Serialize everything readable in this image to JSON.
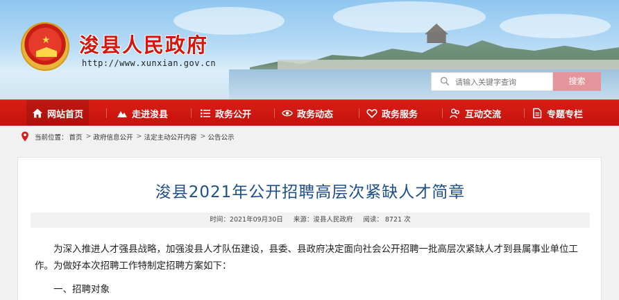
{
  "header": {
    "site_title": "浚县人民政府",
    "site_url": "http://www.xunxian.gov.cn",
    "search": {
      "placeholder": "请输入关键字查询",
      "button_label": "搜索"
    }
  },
  "nav": {
    "items": [
      {
        "label": "网站首页",
        "icon": "home-icon",
        "active": true
      },
      {
        "label": "走进浚县",
        "icon": "mountain-icon"
      },
      {
        "label": "政务公开",
        "icon": "list-icon"
      },
      {
        "label": "政务动态",
        "icon": "eye-icon"
      },
      {
        "label": "政务服务",
        "icon": "heart-icon"
      },
      {
        "label": "互动交流",
        "icon": "people-icon"
      },
      {
        "label": "专题专栏",
        "icon": "document-icon"
      }
    ]
  },
  "breadcrumb": {
    "prefix": "当前位置：",
    "items": [
      "首页",
      "政府信息公开",
      "法定主动公开内容",
      "公告公示"
    ],
    "separator": ">"
  },
  "article": {
    "title": "浚县2021年公开招聘高层次紧缺人才简章",
    "meta": {
      "time": "时间：2021年09月30日",
      "source": "来源：浚县人民政府",
      "views": "阅读： 8721 次"
    },
    "paragraph": "为深入推进人才强县战略，加强浚县人才队伍建设，县委、县政府决定面向社会公开招聘一批高层次紧缺人才到县属事业单位工作。为做好本次招聘工作特制定招聘方案如下：",
    "section_heading": "一、招聘对象"
  },
  "colors": {
    "nav_red": "#d71e16",
    "title_red": "#d6150c",
    "article_title_blue": "#1d4f8c",
    "search_button": "#e4949a"
  }
}
